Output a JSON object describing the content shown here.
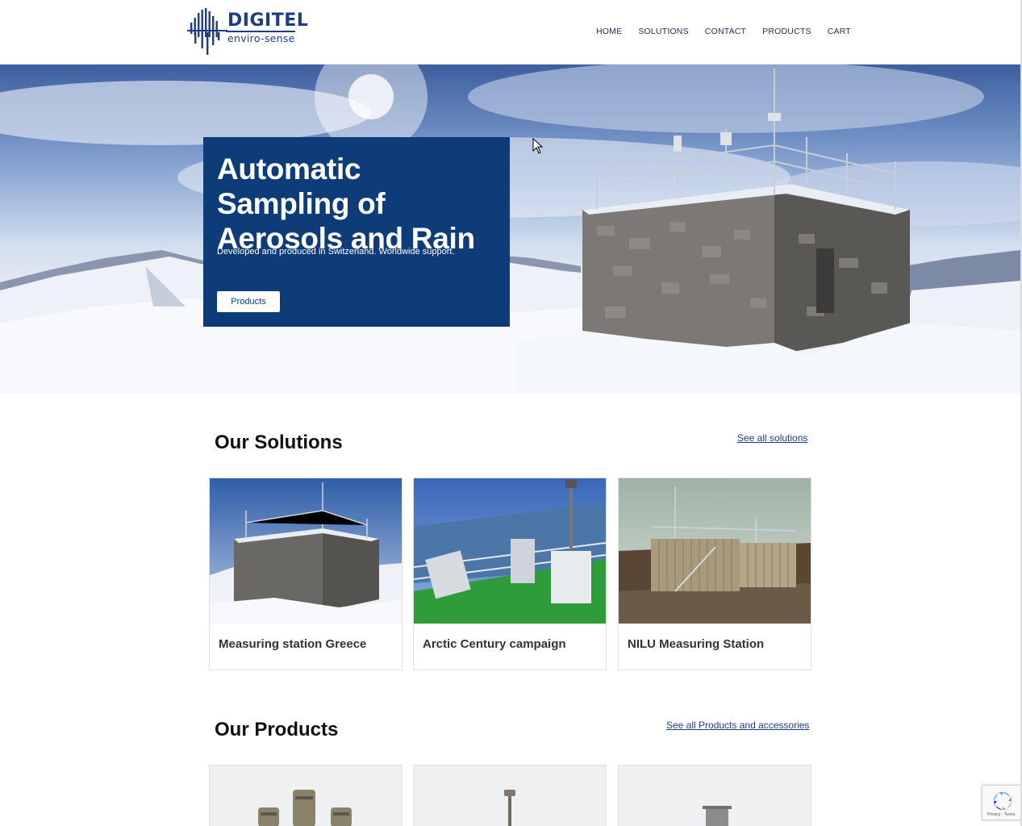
{
  "brand": {
    "name": "DIGITEL",
    "tagline": "enviro-sense"
  },
  "nav": {
    "items": [
      "HOME",
      "SOLUTIONS",
      "CONTACT",
      "PRODUCTS",
      "CART"
    ]
  },
  "hero": {
    "title": "Automatic Sampling of Aerosols and Rain",
    "subtitle": "Developed and produced in Switzerland. Worldwide support.",
    "button_label": "Products"
  },
  "solutions": {
    "title": "Our Solutions",
    "link": "See all solutions",
    "cards": [
      {
        "label": "Measuring station Greece"
      },
      {
        "label": "Arctic Century campaign"
      },
      {
        "label": "NILU Measuring Station"
      }
    ]
  },
  "products": {
    "title": "Our Products",
    "link": "See all Products and accessories"
  },
  "recaptcha": {
    "text": "Privacy - Terms"
  },
  "colors": {
    "brand_blue": "#0d3c78",
    "nav_text": "#1c2f57"
  }
}
